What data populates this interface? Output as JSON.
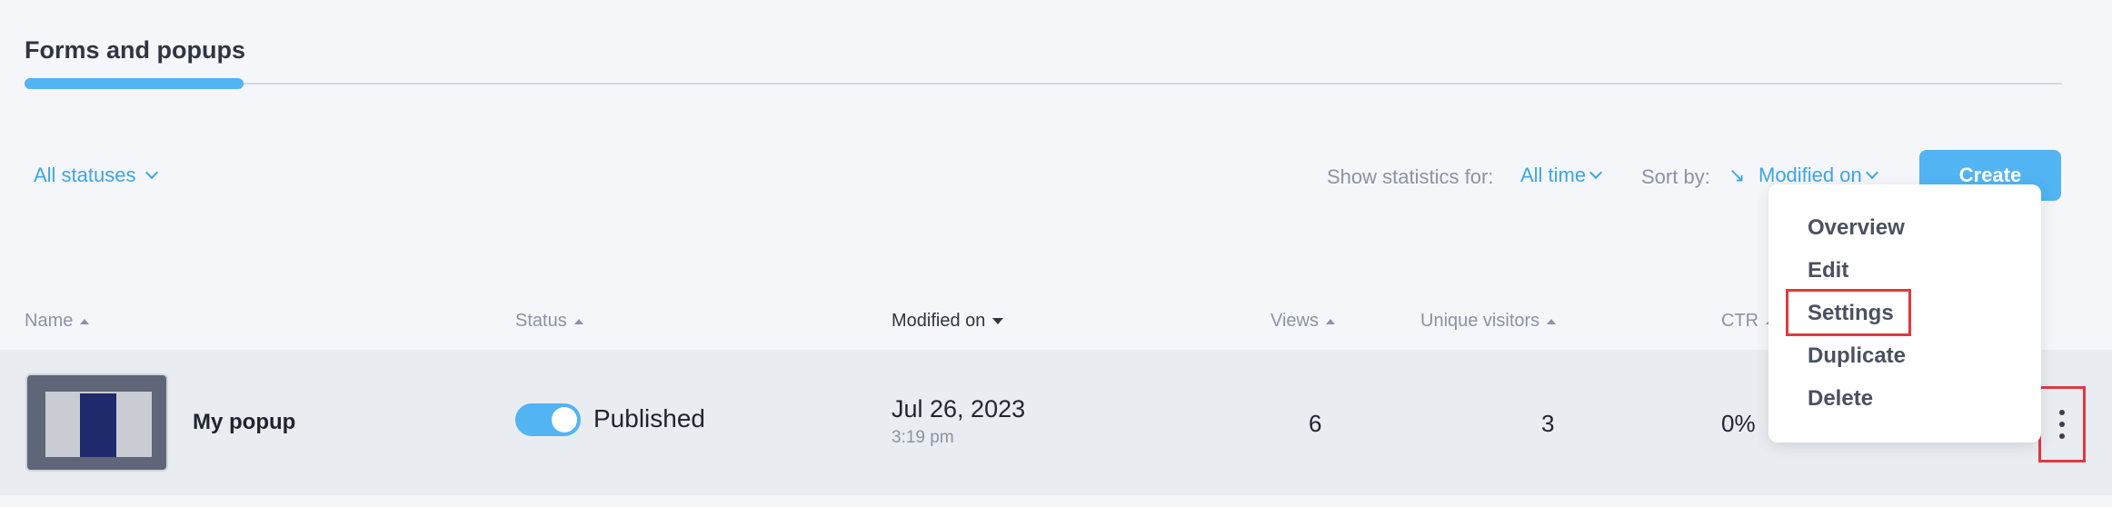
{
  "tabs": {
    "active_label": "Forms and popups"
  },
  "filters": {
    "status_filter": "All statuses"
  },
  "stats": {
    "label": "Show statistics for:",
    "value": "All time"
  },
  "sort": {
    "label": "Sort by:",
    "direction_icon": "↘",
    "value": "Modified on"
  },
  "toolbar": {
    "create_label": "Create"
  },
  "table": {
    "columns": [
      "Name",
      "Status",
      "Modified on",
      "Views",
      "Unique visitors",
      "CTR"
    ],
    "rows": [
      {
        "name": "My popup",
        "status": "Published",
        "modified_date": "Jul 26, 2023",
        "modified_time": "3:19 pm",
        "views": "6",
        "unique_visitors": "3",
        "ctr": "0%"
      }
    ]
  },
  "menu": {
    "items": [
      "Overview",
      "Edit",
      "Settings",
      "Duplicate",
      "Delete"
    ]
  },
  "colors": {
    "accent": "#52b4f2",
    "link": "#3ba6e6",
    "highlight": "#e0393e"
  }
}
